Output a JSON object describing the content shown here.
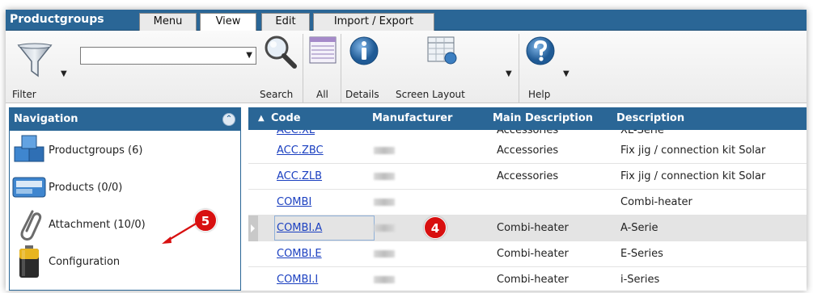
{
  "app": {
    "title": "Productgroups"
  },
  "tabs": [
    {
      "label": "Menu"
    },
    {
      "label": "View"
    },
    {
      "label": "Edit"
    },
    {
      "label": "Import / Export"
    }
  ],
  "toolbar": {
    "filter_label": "Filter",
    "filter_value": "",
    "search_label": "Search",
    "all_label": "All",
    "details_label": "Details",
    "screen_layout_label": "Screen Layout",
    "help_label": "Help"
  },
  "navigation": {
    "title": "Navigation",
    "items": [
      {
        "label": "Productgroups (6)",
        "icon": "cubes-icon"
      },
      {
        "label": "Products (0/0)",
        "icon": "product-box-icon"
      },
      {
        "label": "Attachment (10/0)",
        "icon": "paperclip-icon"
      },
      {
        "label": "Configuration",
        "icon": "battery-icon"
      }
    ]
  },
  "grid": {
    "columns": [
      "Code",
      "Manufacturer",
      "Main Description",
      "Description"
    ],
    "sort_column": "Code",
    "partial_row": {
      "code": "ACC.XL",
      "main": "Accessories",
      "desc": "XL-Serie"
    },
    "rows": [
      {
        "code": "ACC.ZBC",
        "main": "Accessories",
        "desc": "Fix jig / connection kit Solar"
      },
      {
        "code": "ACC.ZLB",
        "main": "Accessories",
        "desc": "Fix jig / connection kit Solar"
      },
      {
        "code": "COMBI",
        "main": "",
        "desc": "Combi-heater"
      },
      {
        "code": "COMBI.A",
        "main": "Combi-heater",
        "desc": "A-Serie",
        "selected": true
      },
      {
        "code": "COMBI.E",
        "main": "Combi-heater",
        "desc": "E-Series"
      },
      {
        "code": "COMBI.I",
        "main": "Combi-heater",
        "desc": "i-Series"
      }
    ]
  },
  "annotations": [
    {
      "label": "4"
    },
    {
      "label": "5"
    }
  ],
  "colors": {
    "header_blue": "#2a6696",
    "link": "#1a3fc0",
    "badge_red": "#d81010"
  }
}
